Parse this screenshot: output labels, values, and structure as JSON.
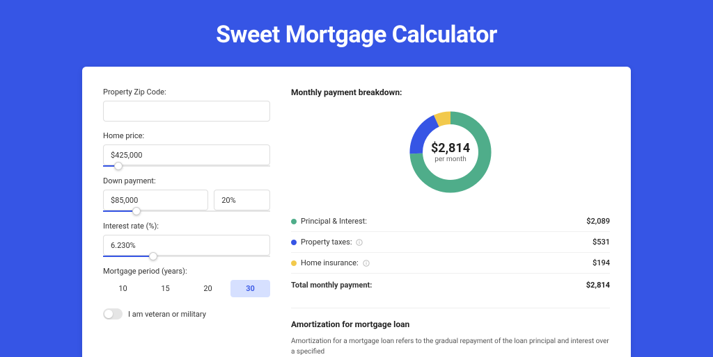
{
  "page": {
    "title": "Sweet Mortgage Calculator"
  },
  "form": {
    "zip": {
      "label": "Property Zip Code:",
      "value": ""
    },
    "home_price": {
      "label": "Home price:",
      "value": "$425,000",
      "slider_pct": 9
    },
    "down_payment": {
      "label": "Down payment:",
      "amount": "$85,000",
      "pct": "20%",
      "slider_pct": 20
    },
    "interest_rate": {
      "label": "Interest rate (%):",
      "value": "6.230%",
      "slider_pct": 30
    },
    "period": {
      "label": "Mortgage period (years):",
      "options": [
        "10",
        "15",
        "20",
        "30"
      ],
      "selected": "30"
    },
    "veteran": {
      "label": "I am veteran or military",
      "checked": false
    }
  },
  "breakdown": {
    "title": "Monthly payment breakdown:",
    "center_value": "$2,814",
    "center_sub": "per month",
    "items": [
      {
        "label": "Principal & Interest:",
        "value": "$2,089",
        "color": "#4fad8a",
        "info": false
      },
      {
        "label": "Property taxes:",
        "value": "$531",
        "color": "#3655e5",
        "info": true
      },
      {
        "label": "Home insurance:",
        "value": "$194",
        "color": "#f2c94c",
        "info": true
      }
    ],
    "total": {
      "label": "Total monthly payment:",
      "value": "$2,814"
    }
  },
  "amortization": {
    "title": "Amortization for mortgage loan",
    "text": "Amortization for a mortgage loan refers to the gradual repayment of the loan principal and interest over a specified"
  },
  "chart_data": {
    "type": "pie",
    "title": "Monthly payment breakdown",
    "series": [
      {
        "name": "Principal & Interest",
        "value": 2089,
        "color": "#4fad8a"
      },
      {
        "name": "Property taxes",
        "value": 531,
        "color": "#3655e5"
      },
      {
        "name": "Home insurance",
        "value": 194,
        "color": "#f2c94c"
      }
    ],
    "total": 2814,
    "currency": "USD",
    "unit": "per month"
  }
}
